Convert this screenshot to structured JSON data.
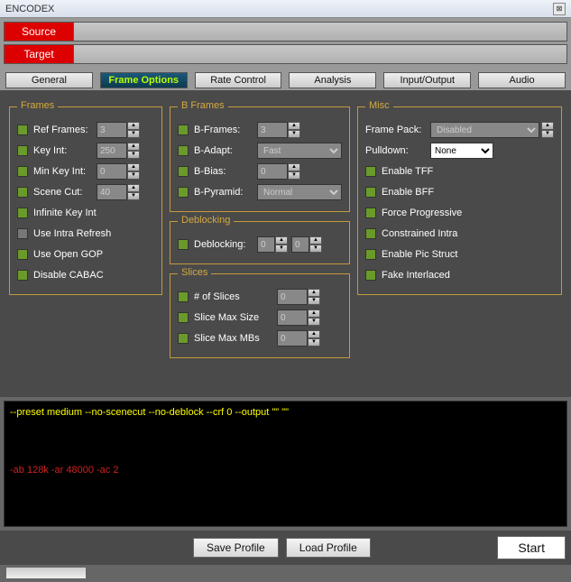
{
  "window": {
    "title": "ENCODEX"
  },
  "bars": {
    "source": "Source",
    "target": "Target"
  },
  "tabs": [
    "General",
    "Frame Options",
    "Rate Control",
    "Analysis",
    "Input/Output",
    "Audio"
  ],
  "frames": {
    "title": "Frames",
    "ref_frames": {
      "label": "Ref Frames:",
      "value": "3"
    },
    "key_int": {
      "label": "Key Int:",
      "value": "250"
    },
    "min_key_int": {
      "label": "Min Key Int:",
      "value": "0"
    },
    "scene_cut": {
      "label": "Scene Cut:",
      "value": "40"
    },
    "infinite_key_int": "Infinite Key Int",
    "use_intra_refresh": "Use Intra Refresh",
    "use_open_gop": "Use Open GOP",
    "disable_cabac": "Disable CABAC"
  },
  "bframes": {
    "title": "B Frames",
    "b_frames": {
      "label": "B-Frames:",
      "value": "3"
    },
    "b_adapt": {
      "label": "B-Adapt:",
      "value": "Fast"
    },
    "b_bias": {
      "label": "B-Bias:",
      "value": "0"
    },
    "b_pyramid": {
      "label": "B-Pyramid:",
      "value": "Normal"
    }
  },
  "deblocking": {
    "title": "Deblocking",
    "label": "Deblocking:",
    "v1": "0",
    "v2": "0"
  },
  "slices": {
    "title": "Slices",
    "num": {
      "label": "# of Slices",
      "value": "0"
    },
    "max_size": {
      "label": "Slice Max Size",
      "value": "0"
    },
    "max_mbs": {
      "label": "Slice Max MBs",
      "value": "0"
    }
  },
  "misc": {
    "title": "Misc",
    "frame_pack": {
      "label": "Frame Pack:",
      "value": "Disabled"
    },
    "pulldown": {
      "label": "Pulldown:",
      "value": "None"
    },
    "enable_tff": "Enable TFF",
    "enable_bff": "Enable BFF",
    "force_progressive": "Force Progressive",
    "constrained_intra": "Constrained Intra",
    "enable_pic_struct": "Enable Pic Struct",
    "fake_interlaced": "Fake Interlaced"
  },
  "output": {
    "video": "--preset medium --no-scenecut --no-deblock --crf 0 --output \"\" \"\"",
    "audio": "-ab 128k -ar 48000 -ac 2"
  },
  "footer": {
    "save": "Save Profile",
    "load": "Load Profile",
    "start": "Start"
  }
}
